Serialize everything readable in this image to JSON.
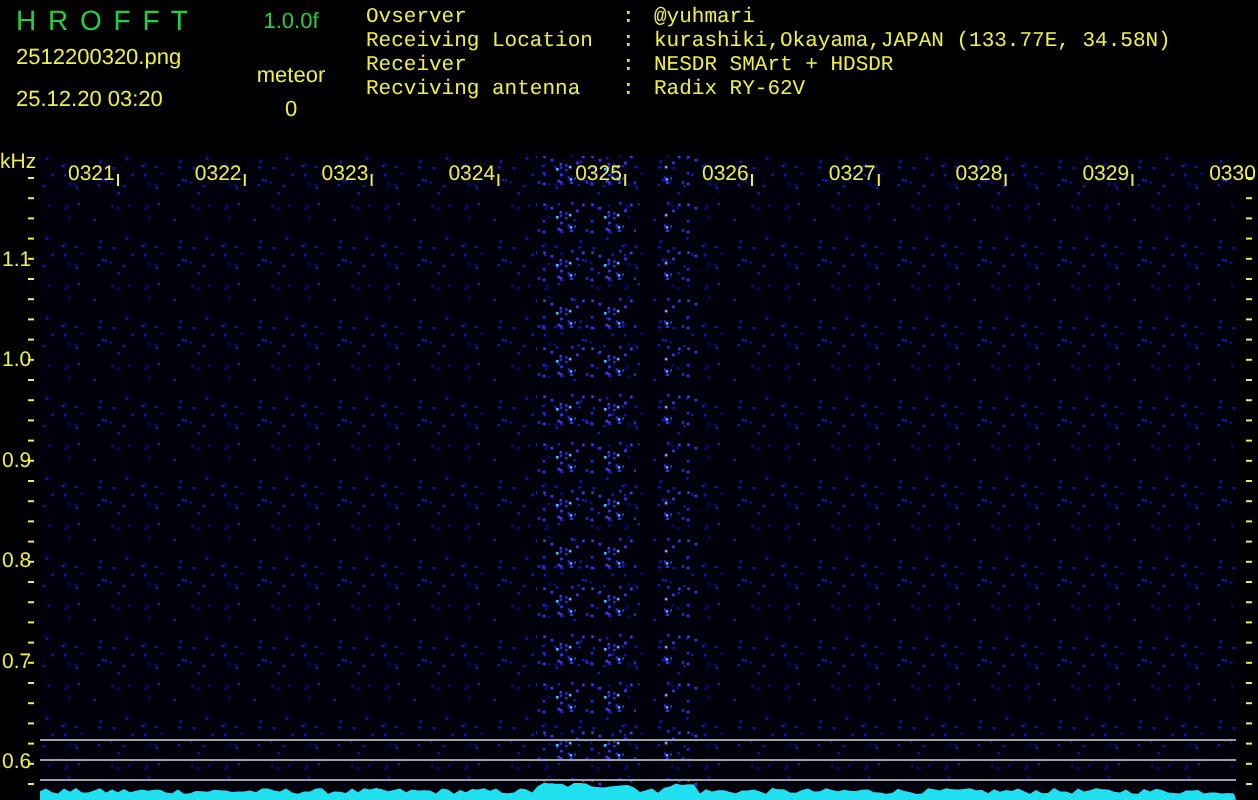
{
  "app": {
    "title": "H R O F F T",
    "version": "1.0.0f",
    "filename": "2512200320.png",
    "datetime": "25.12.20 03:20",
    "counter_label": "meteor",
    "counter_value": "0"
  },
  "info": [
    {
      "label": "Ovserver",
      "separator": ":",
      "value": "@yuhmari"
    },
    {
      "label": "Receiving Location",
      "separator": ":",
      "value": "kurashiki,Okayama,JAPAN (133.77E, 34.58N)"
    },
    {
      "label": "Receiver",
      "separator": ":",
      "value": "NESDR SMArt + HDSDR"
    },
    {
      "label": "Recviving antenna",
      "separator": ":",
      "value": "Radix RY-62V"
    }
  ],
  "spectrogram": {
    "y_unit": "kHz",
    "y_labels": [
      "1.1",
      "1.0",
      "0.9",
      "0.8",
      "0.7",
      "0.6"
    ],
    "time_labels": [
      "0321",
      "0322",
      "0323",
      "0324",
      "0325",
      "0326",
      "0327",
      "0328",
      "0329",
      "0330"
    ]
  }
}
